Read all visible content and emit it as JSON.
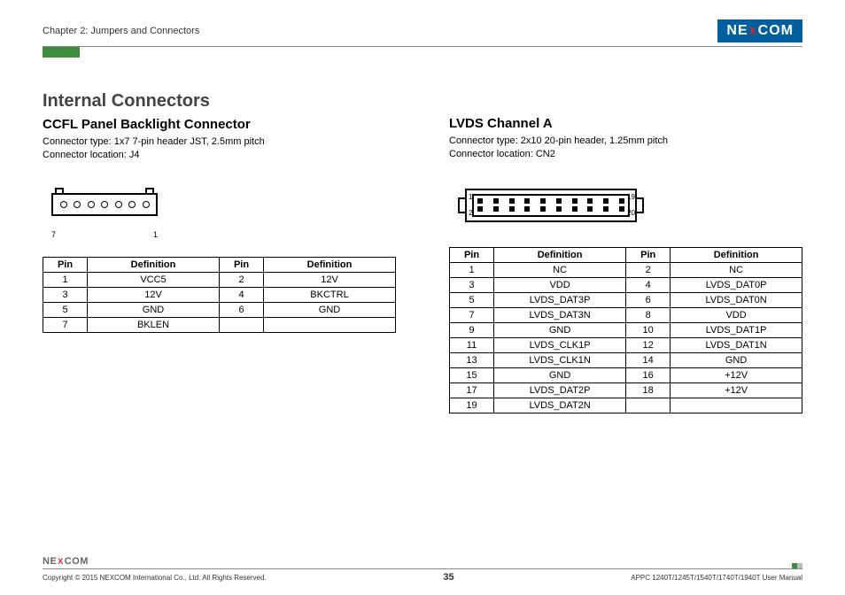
{
  "header": {
    "chapter": "Chapter 2: Jumpers and Connectors",
    "logo_parts": [
      "NE",
      "X",
      "COM"
    ]
  },
  "title": "Internal Connectors",
  "left": {
    "heading": "CCFL Panel Backlight Connector",
    "conn_type": "Connector type: 1x7 7-pin header JST, 2.5mm pitch",
    "conn_loc": "Connector location: J4",
    "label_left": "7",
    "label_right": "1",
    "th_pin": "Pin",
    "th_def": "Definition",
    "rows": [
      {
        "p1": "1",
        "d1": "VCC5",
        "p2": "2",
        "d2": "12V"
      },
      {
        "p1": "3",
        "d1": "12V",
        "p2": "4",
        "d2": "BKCTRL"
      },
      {
        "p1": "5",
        "d1": "GND",
        "p2": "6",
        "d2": "GND"
      },
      {
        "p1": "7",
        "d1": "BKLEN",
        "p2": "",
        "d2": ""
      }
    ]
  },
  "right": {
    "heading": "LVDS Channel A",
    "conn_type": "Connector type: 2x10 20-pin header, 1.25mm pitch",
    "conn_loc": "Connector location: CN2",
    "n1": "1",
    "n2": "2",
    "n19": "19",
    "n20": "20",
    "th_pin": "Pin",
    "th_def": "Definition",
    "rows": [
      {
        "p1": "1",
        "d1": "NC",
        "p2": "2",
        "d2": "NC"
      },
      {
        "p1": "3",
        "d1": "VDD",
        "p2": "4",
        "d2": "LVDS_DAT0P"
      },
      {
        "p1": "5",
        "d1": "LVDS_DAT3P",
        "p2": "6",
        "d2": "LVDS_DAT0N"
      },
      {
        "p1": "7",
        "d1": "LVDS_DAT3N",
        "p2": "8",
        "d2": "VDD"
      },
      {
        "p1": "9",
        "d1": "GND",
        "p2": "10",
        "d2": "LVDS_DAT1P"
      },
      {
        "p1": "11",
        "d1": "LVDS_CLK1P",
        "p2": "12",
        "d2": "LVDS_DAT1N"
      },
      {
        "p1": "13",
        "d1": "LVDS_CLK1N",
        "p2": "14",
        "d2": "GND"
      },
      {
        "p1": "15",
        "d1": "GND",
        "p2": "16",
        "d2": "+12V"
      },
      {
        "p1": "17",
        "d1": "LVDS_DAT2P",
        "p2": "18",
        "d2": "+12V"
      },
      {
        "p1": "19",
        "d1": "LVDS_DAT2N",
        "p2": "",
        "d2": ""
      }
    ]
  },
  "footer": {
    "copyright": "Copyright © 2015 NEXCOM International Co., Ltd. All Rights Reserved.",
    "page": "35",
    "doc": "APPC 1240T/1245T/1540T/1740T/1940T User Manual",
    "logo_parts": [
      "NE",
      "X",
      "COM"
    ]
  }
}
